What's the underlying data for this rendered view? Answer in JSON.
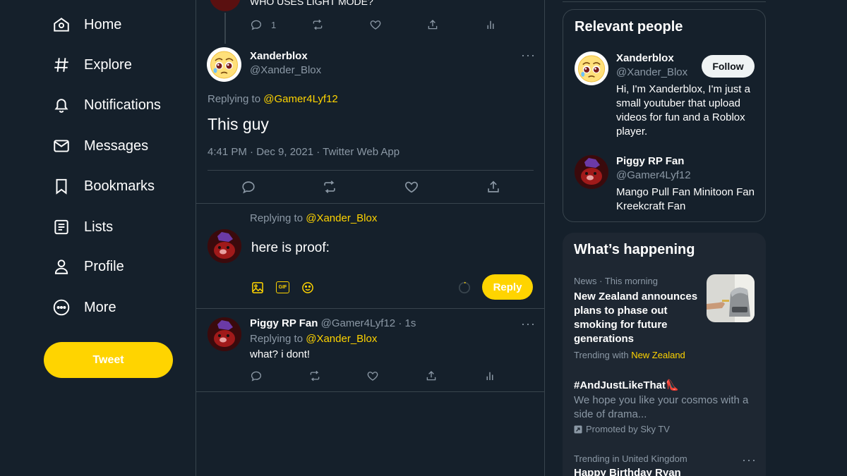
{
  "nav": {
    "items": [
      {
        "label": "Home",
        "icon": "home-icon"
      },
      {
        "label": "Explore",
        "icon": "hashtag-icon"
      },
      {
        "label": "Notifications",
        "icon": "bell-icon"
      },
      {
        "label": "Messages",
        "icon": "envelope-icon"
      },
      {
        "label": "Bookmarks",
        "icon": "bookmark-icon"
      },
      {
        "label": "Lists",
        "icon": "list-icon"
      },
      {
        "label": "Profile",
        "icon": "person-icon"
      },
      {
        "label": "More",
        "icon": "more-circle-icon"
      }
    ],
    "tweet_button": "Tweet"
  },
  "thread": {
    "previous_tweet": {
      "text_fragment": "WHO USES LIGHT MODE?",
      "reply_count": "1"
    },
    "main_tweet": {
      "name": "Xanderblox",
      "handle": "@Xander_Blox",
      "replying_prefix": "Replying to",
      "replying_to": "@Gamer4Lyf12",
      "text": "This guy",
      "meta": "4:41 PM · Dec 9, 2021 · Twitter Web App"
    },
    "composer": {
      "replying_prefix": "Replying to",
      "replying_to": "@Xander_Blox",
      "draft": "here is proof:",
      "gif_label": "GIF",
      "reply_button": "Reply"
    },
    "reply": {
      "name": "Piggy RP Fan",
      "handle": "@Gamer4Lyf12",
      "time": "· 1s",
      "replying_prefix": "Replying to",
      "replying_to": "@Xander_Blox",
      "text": "what? i dont!"
    }
  },
  "sidebar": {
    "relevant_people": {
      "title": "Relevant people",
      "people": [
        {
          "name": "Xanderblox",
          "handle": "@Xander_Blox",
          "bio": "Hi, I'm Xanderblox, I'm just a small youtuber that upload videos for fun and a Roblox player.",
          "follow_label": "Follow"
        },
        {
          "name": "Piggy RP Fan",
          "handle": "@Gamer4Lyf12",
          "bio": "Mango Pull Fan Minitoon Fan Kreekcraft Fan"
        }
      ]
    },
    "whats_happening": {
      "title": "What’s happening",
      "items": [
        {
          "context": "News · This morning",
          "headline": "New Zealand announces plans to phase out smoking for future generations",
          "trending_prefix": "Trending with",
          "trending_with": "New Zealand"
        },
        {
          "headline": "#AndJustLikeThat👠",
          "description": "We hope you like your cosmos with a side of drama...",
          "promoted": "Promoted by Sky TV"
        },
        {
          "context": "Trending in United Kingdom",
          "headline": "Happy Birthday Ryan"
        }
      ]
    }
  },
  "colors": {
    "background": "#15202b",
    "border": "#38444d",
    "accent": "#ffd400",
    "muted_text": "#8b98a5"
  }
}
